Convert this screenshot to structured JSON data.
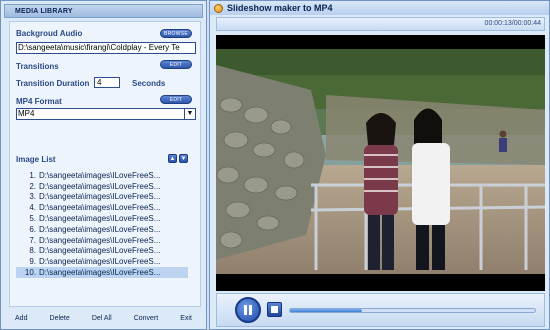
{
  "left_panel": {
    "title": "MEDIA LIBRARY",
    "background_audio_label": "Backgroud Audio",
    "browse_label": "BROWSE",
    "audio_path": "D:\\sangeeta\\music\\firangi\\Coldplay - Every Te",
    "transitions_label": "Transitions",
    "transitions_edit": "EDIT",
    "transition_duration_label": "Transition Duration",
    "transition_duration_value": "4",
    "seconds_label": "Seconds",
    "mp4_format_label": "MP4 Format",
    "mp4_format_edit": "EDIT",
    "mp4_format_value": "MP4",
    "image_list_label": "Image List",
    "images": [
      {
        "num": "1.",
        "path": "D:\\sangeeta\\images\\ILoveFreeS..."
      },
      {
        "num": "2.",
        "path": "D:\\sangeeta\\images\\ILoveFreeS..."
      },
      {
        "num": "3.",
        "path": "D:\\sangeeta\\images\\ILoveFreeS..."
      },
      {
        "num": "4.",
        "path": "D:\\sangeeta\\images\\ILoveFreeS..."
      },
      {
        "num": "5.",
        "path": "D:\\sangeeta\\images\\ILoveFreeS..."
      },
      {
        "num": "6.",
        "path": "D:\\sangeeta\\images\\ILoveFreeS..."
      },
      {
        "num": "7.",
        "path": "D:\\sangeeta\\images\\ILoveFreeS..."
      },
      {
        "num": "8.",
        "path": "D:\\sangeeta\\images\\ILoveFreeS..."
      },
      {
        "num": "9.",
        "path": "D:\\sangeeta\\images\\ILoveFreeS..."
      },
      {
        "num": "10.",
        "path": "D:\\sangeeta\\images\\ILoveFreeS..."
      }
    ],
    "selected_index": 9,
    "bottom_buttons": {
      "add": "Add",
      "delete": "Delete",
      "del_all": "Del All",
      "convert": "Convert",
      "exit": "Exit"
    }
  },
  "right_panel": {
    "window_title": "Slideshow maker to MP4",
    "time_display": "00:00:13/00:00:44",
    "progress_fraction": 0.295
  },
  "icons": {
    "app": "app-icon",
    "play": "play-icon",
    "stop": "stop-icon",
    "move_up": "arrow-up-icon",
    "move_down": "arrow-down-icon",
    "dropdown": "chevron-down-icon"
  }
}
